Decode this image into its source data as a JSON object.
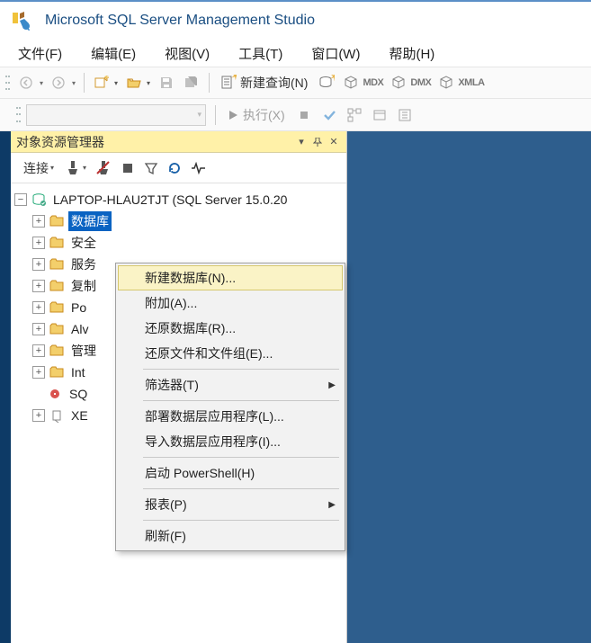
{
  "app": {
    "title": "Microsoft SQL Server Management Studio"
  },
  "menu": {
    "file": "文件(F)",
    "edit": "编辑(E)",
    "view": "视图(V)",
    "tools": "工具(T)",
    "window": "窗口(W)",
    "help": "帮助(H)"
  },
  "toolbar": {
    "new_query": "新建查询(N)",
    "mdx": "MDX",
    "dmx": "DMX",
    "xmla": "XMLA",
    "execute": "执行(X)"
  },
  "panel": {
    "title": "对象资源管理器",
    "connect": "连接"
  },
  "tree": {
    "server": "LAPTOP-HLAU2TJT (SQL Server 15.0.20",
    "nodes": [
      "数据库",
      "安全",
      "服务",
      "复制",
      "Po",
      "Alv",
      "管理",
      "Int",
      "SQ",
      "XE"
    ]
  },
  "ctx": {
    "new_db": "新建数据库(N)...",
    "attach": "附加(A)...",
    "restore_db": "还原数据库(R)...",
    "restore_fg": "还原文件和文件组(E)...",
    "filter": "筛选器(T)",
    "deploy": "部署数据层应用程序(L)...",
    "import": "导入数据层应用程序(I)...",
    "ps": "启动 PowerShell(H)",
    "reports": "报表(P)",
    "refresh": "刷新(F)"
  }
}
